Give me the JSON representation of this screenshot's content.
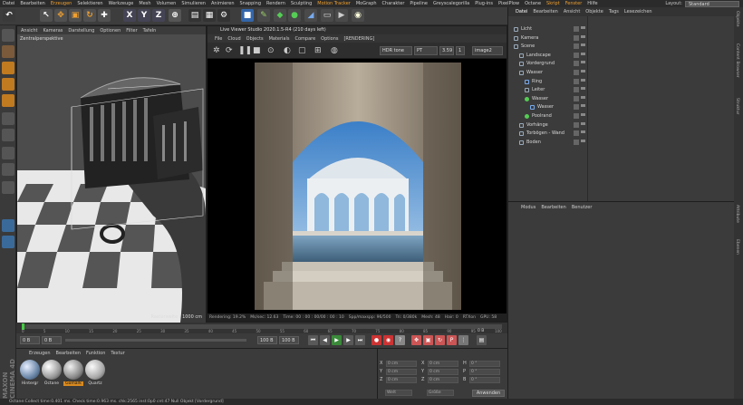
{
  "menubar": {
    "items": [
      "Datei",
      "Bearbeiten",
      "Erzeugen",
      "Selektieren",
      "Werkzeuge",
      "Mesh",
      "Volumen",
      "Simulieren",
      "Animieren",
      "Snapping",
      "Rendern",
      "Sculpting",
      "Motion Tracker",
      "MoGraph",
      "Charakter",
      "Pipeline",
      "Greyscalegorilla",
      "Plug-ins",
      "PixelPlow",
      "Octane",
      "Skript",
      "Fenster",
      "Hilfe"
    ],
    "layout_label": "Layout:",
    "layout_value": "Standard"
  },
  "toolbar": {
    "axis_x": "X",
    "axis_y": "Y",
    "axis_z": "Z"
  },
  "viewport": {
    "menu": [
      "Ansicht",
      "Kameras",
      "Darstellung",
      "Optionen",
      "Filter",
      "Tafeln"
    ],
    "label": "Zentralperspektive",
    "grid_label": "Rasterweite : 1000 cm"
  },
  "live_viewer": {
    "title": "Live Viewer Studio 2020.1.5-R4 (210 days left)",
    "menu": [
      "File",
      "Cloud",
      "Objects",
      "Materials",
      "Compare",
      "Options",
      "[RENDERING]"
    ],
    "tonemap": "HDR tone",
    "channel": "PT",
    "value": "3.59",
    "fps": "1",
    "image_label": "image2",
    "status": [
      "Rendering: 19.2%",
      "Ms/sec: 12.63",
      "Time: 00 : 00 : 00/00 : 00 : 10",
      "Spp/maxspp: 96/500",
      "Tri: 0/380k",
      "Mesh: 48",
      "Hair: 0",
      "RTXon",
      "GPU: 58"
    ]
  },
  "object_manager": {
    "tabs": [
      "Datei",
      "Bearbeiten",
      "Ansicht",
      "Objekte",
      "Tags",
      "Lesezeichen"
    ],
    "objects": [
      {
        "name": "Licht",
        "indent": 0,
        "icon": "null"
      },
      {
        "name": "Kamera",
        "indent": 0,
        "icon": "camera"
      },
      {
        "name": "Scene",
        "indent": 0,
        "icon": "null"
      },
      {
        "name": "Landscape",
        "indent": 1,
        "icon": "null"
      },
      {
        "name": "Vordergrund",
        "indent": 1,
        "icon": "null"
      },
      {
        "name": "Wasser",
        "indent": 1,
        "icon": "null"
      },
      {
        "name": "Ring",
        "indent": 2,
        "icon": "torus"
      },
      {
        "name": "Leiter",
        "indent": 2,
        "icon": "null"
      },
      {
        "name": "Wasser",
        "indent": 2,
        "icon": "sphere"
      },
      {
        "name": "Wasser",
        "indent": 3,
        "icon": "plane"
      },
      {
        "name": "Poolrand",
        "indent": 2,
        "icon": "green"
      },
      {
        "name": "Vorhänge",
        "indent": 1,
        "icon": "null"
      },
      {
        "name": "Torbögen - Wand",
        "indent": 1,
        "icon": "null"
      },
      {
        "name": "Boden",
        "indent": 1,
        "icon": "null"
      }
    ]
  },
  "attribute_manager": {
    "tabs": [
      "Modus",
      "Bearbeiten",
      "Benutzer"
    ]
  },
  "right_side_tabs": [
    "Objekte",
    "Content Browser",
    "Struktur",
    "Attribute",
    "Ebenen"
  ],
  "timeline": {
    "ticks": [
      "0",
      "5",
      "10",
      "15",
      "20",
      "25",
      "30",
      "35",
      "40",
      "45",
      "50",
      "55",
      "60",
      "65",
      "70",
      "75",
      "80",
      "85",
      "90",
      "95",
      "100"
    ],
    "frame_label": "0 B"
  },
  "transport": {
    "start": "0 B",
    "current": "0 B",
    "end": "100 B",
    "end2": "100 B"
  },
  "material_manager": {
    "tabs": [
      "Erzeugen",
      "Bearbeiten",
      "Funktion",
      "Textur"
    ],
    "materials": [
      "Hintergr",
      "Octane",
      "Gomark",
      "Quartz"
    ]
  },
  "coordinates": {
    "rows": [
      {
        "a": "X",
        "av": "0 cm",
        "b": "X",
        "bv": "0 cm",
        "c": "H",
        "cv": "0 °"
      },
      {
        "a": "Y",
        "av": "0 cm",
        "b": "Y",
        "bv": "0 cm",
        "c": "P",
        "cv": "0 °"
      },
      {
        "a": "Z",
        "av": "0 cm",
        "b": "Z",
        "bv": "0 cm",
        "c": "B",
        "cv": "0 °"
      }
    ],
    "mode1": "Welt",
    "mode2": "Größe",
    "apply": "Anwenden"
  },
  "statusbar": {
    "text": "Octane:Collect time:0.401 ms.  Check time:0.963 ms.  chk:2565  inst:0p0  cnt:47      Null Objekt [Vordergrund]"
  },
  "brand": "MAXON CINEMA 4D",
  "colors": {
    "accent": "#f0a030",
    "bg": "#3a3a3a"
  }
}
